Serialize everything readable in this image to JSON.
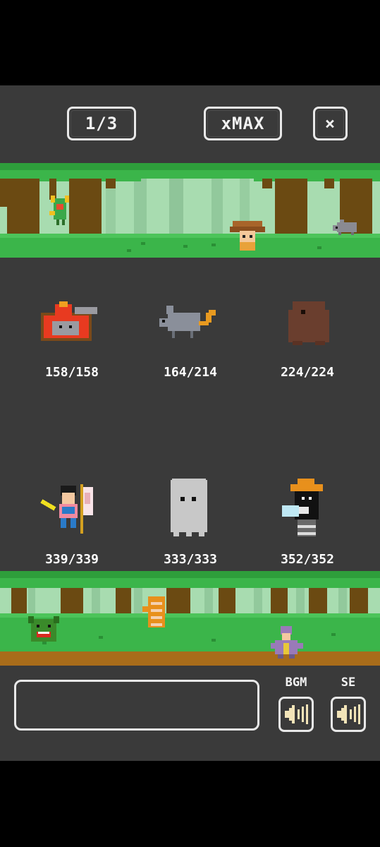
{
  "header": {
    "page_indicator": "1/3",
    "multiplier_label": "xMAX",
    "close_label": "×"
  },
  "monsters": [
    {
      "name": "helmet-crate-monster",
      "hp": "158/158"
    },
    {
      "name": "gray-rat-monster",
      "hp": "164/214"
    },
    {
      "name": "brown-blob-monster",
      "hp": "224/224"
    },
    {
      "name": "flag-girl-monster",
      "hp": "339/339"
    },
    {
      "name": "white-ghost-monster",
      "hp": "333/333"
    },
    {
      "name": "hooded-mage-monster",
      "hp": "352/352"
    }
  ],
  "footer": {
    "message": "",
    "bgm_label": "BGM",
    "se_label": "SE"
  },
  "colors": {
    "background": "#3a3a3a",
    "grass": "#3bb54a",
    "sky": "#9fd6a8",
    "trunk": "#6b4a12"
  }
}
